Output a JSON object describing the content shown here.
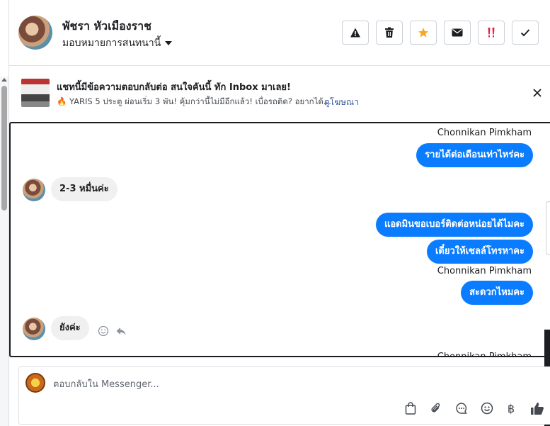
{
  "contact": {
    "name": "พัชรา หัวเมืองราช",
    "assign_label": "มอบหมายการสนทนานี้"
  },
  "toolbar": {
    "buttons": [
      {
        "name": "spam",
        "icon": "warning-icon"
      },
      {
        "name": "delete",
        "icon": "trash-icon"
      },
      {
        "name": "star",
        "icon": "star-icon",
        "color": "#f5a623"
      },
      {
        "name": "mark-unread",
        "icon": "envelope-icon"
      },
      {
        "name": "follow-up",
        "icon": "double-exclamation-icon",
        "color": "#e41e3f"
      },
      {
        "name": "done",
        "icon": "checkmark-icon"
      }
    ]
  },
  "ad": {
    "title": "แชทนี้มีข้อความตอบกลับต่อ สนใจคันนี้ ทัก Inbox มาเลย!",
    "description_icon": "🔥",
    "description": "YARIS 5 ประตู ผ่อนเริ่ม 3 พัน! คุ้มกว่านี้ไม่มีอีกแล้ว! เบื่อรถติด? อยากได้...",
    "link": "ดูโฆษณา"
  },
  "messages": [
    {
      "type": "sender",
      "text": "Chonnikan Pimkham"
    },
    {
      "type": "outgoing",
      "text": "รายได้ต่อเดือนเท่าไหร่คะ"
    },
    {
      "type": "incoming",
      "text": "2-3 หมื่นค่ะ"
    },
    {
      "type": "outgoing",
      "text": "แอดมินขอเบอร์ติดต่อหน่อยได้ไมคะ"
    },
    {
      "type": "outgoing",
      "text": "เดี๋ยวให้เซลล์โทรหาคะ"
    },
    {
      "type": "sender",
      "text": "Chonnikan Pimkham"
    },
    {
      "type": "outgoing",
      "text": "สะดวกไหมคะ"
    },
    {
      "type": "incoming",
      "text": "ยังค่ะ"
    },
    {
      "type": "sender",
      "text": "Chonnikan Pimkham"
    }
  ],
  "composer": {
    "placeholder": "ตอบกลับใน Messenger...",
    "baht_symbol": "฿"
  },
  "colors": {
    "accent": "#0a7cff",
    "link": "#385898"
  }
}
